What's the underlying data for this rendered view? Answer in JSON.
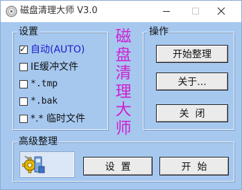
{
  "window": {
    "title": "磁盘清理大师 V3.0"
  },
  "settings": {
    "group_title": "设置",
    "options": [
      {
        "label": "自动(AUTO)",
        "checked": true
      },
      {
        "label": "IE缓冲文件",
        "checked": false
      },
      {
        "label": "*.tmp",
        "checked": false
      },
      {
        "label": "*.bak",
        "checked": false
      },
      {
        "label": "*.* 临时文件",
        "checked": false
      }
    ]
  },
  "brand": {
    "chars": [
      "磁",
      "盘",
      "清",
      "理",
      "大",
      "师"
    ],
    "color": "#d020d0"
  },
  "operations": {
    "group_title": "操作",
    "start_clean_label": "开始整理",
    "about_label": "关于...",
    "close_label": "关  闭"
  },
  "advanced": {
    "group_title": "高级整理",
    "settings_label": "设  置",
    "start_label": "开  始",
    "icon": "gears-tools-icon"
  },
  "colors": {
    "background": "#a6c8ef",
    "brand": "#d020d0",
    "active_option": "#1a1acc"
  }
}
